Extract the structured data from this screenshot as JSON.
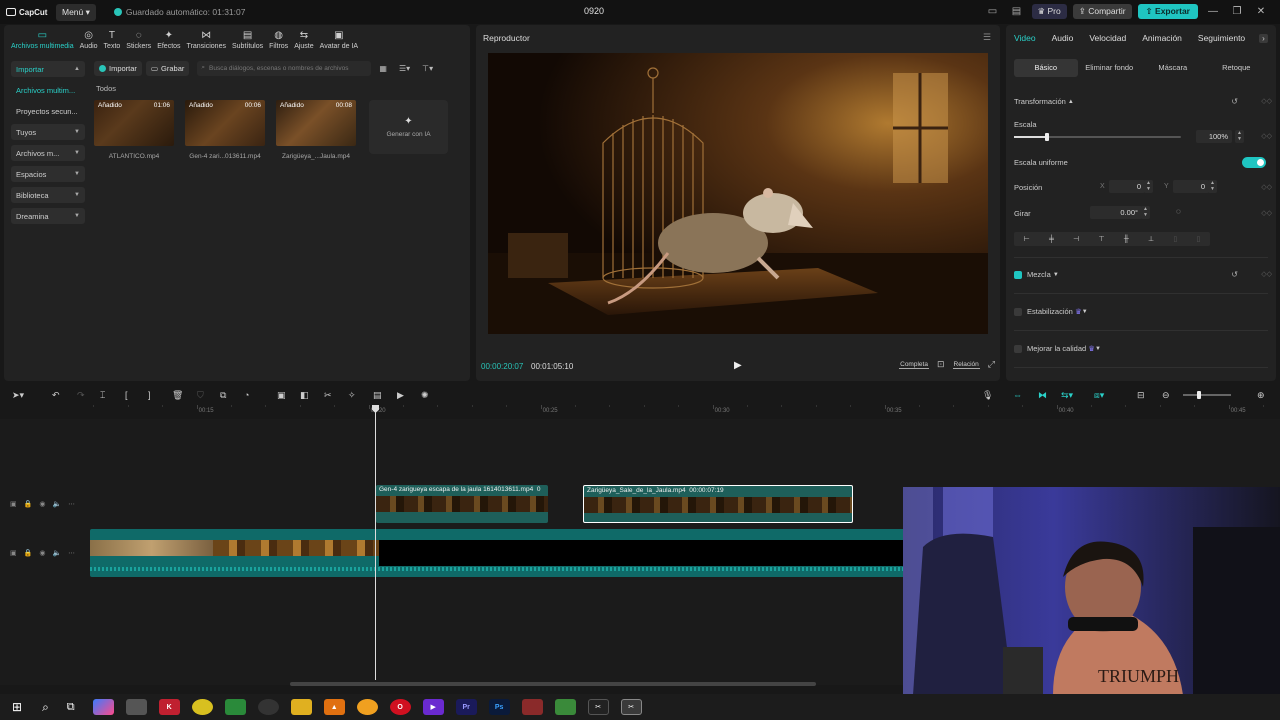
{
  "app": {
    "logo_text": "CapCut",
    "menu_label": "Menú",
    "autosave_text": "Guardado automático: 01:31:07",
    "project_title": "0920",
    "pro_label": "Pro",
    "share_label": "Compartir",
    "export_label": "Exportar"
  },
  "media_tabs": [
    {
      "label": "Archivos multimedia",
      "icon": "media-icon",
      "active": true
    },
    {
      "label": "Audio",
      "icon": "audio-icon"
    },
    {
      "label": "Texto",
      "icon": "text-icon"
    },
    {
      "label": "Stickers",
      "icon": "sticker-icon"
    },
    {
      "label": "Efectos",
      "icon": "effects-icon"
    },
    {
      "label": "Transiciones",
      "icon": "transitions-icon"
    },
    {
      "label": "Subtítulos",
      "icon": "subtitles-icon"
    },
    {
      "label": "Filtros",
      "icon": "filters-icon"
    },
    {
      "label": "Ajuste",
      "icon": "adjust-icon"
    },
    {
      "label": "Avatar de IA",
      "icon": "avatar-icon"
    }
  ],
  "side_nav": [
    {
      "label": "Importar",
      "boxed": true,
      "active": true
    },
    {
      "label": "Archivos multim...",
      "boxed": false,
      "active": true
    },
    {
      "label": "Proyectos secun...",
      "boxed": false
    },
    {
      "label": "Tuyos",
      "boxed": true
    },
    {
      "label": "Archivos m...",
      "boxed": true
    },
    {
      "label": "Espacios",
      "boxed": true
    },
    {
      "label": "Biblioteca",
      "boxed": true
    },
    {
      "label": "Dreamina",
      "boxed": true
    }
  ],
  "media_toolbar": {
    "import_label": "Importar",
    "record_label": "Grabar",
    "search_placeholder": "Busca diálogos, escenas o nombres de archivos"
  },
  "media_section_title": "Todos",
  "media_items": [
    {
      "badge": "Añadido",
      "duration": "01:06",
      "name": "ATLANTICO.mp4"
    },
    {
      "badge": "Añadido",
      "duration": "00:06",
      "name": "Gen-4 zari...013611.mp4"
    },
    {
      "badge": "Añadido",
      "duration": "00:08",
      "name": "Zarigüeya_...Jaula.mp4"
    }
  ],
  "generate_ai_label": "Generar con IA",
  "player": {
    "title": "Reproductor",
    "current_time": "00:00:20:07",
    "total_time": "00:01:05:10",
    "full_label": "Completa",
    "ratio_label": "Relación"
  },
  "props": {
    "tabs": [
      "Video",
      "Audio",
      "Velocidad",
      "Animación",
      "Seguimiento"
    ],
    "subtabs": [
      "Básico",
      "Eliminar fondo",
      "Máscara",
      "Retoque"
    ],
    "transform_label": "Transformación",
    "scale_label": "Escala",
    "scale_value": "100%",
    "scale_fraction": 0.2,
    "uniform_scale_label": "Escala uniforme",
    "position_label": "Posición",
    "pos_x_label": "X",
    "pos_x": "0",
    "pos_y_label": "Y",
    "pos_y": "0",
    "rotate_label": "Girar",
    "rotate_value": "0.00°",
    "blend_label": "Mezcla",
    "stabilize_label": "Estabilización",
    "quality_label": "Mejorar la calidad"
  },
  "timeline": {
    "ruler": [
      {
        "label": "00:15"
      },
      {
        "label": "00:20"
      },
      {
        "label": "00:25"
      },
      {
        "label": "00:30"
      },
      {
        "label": "00:35"
      },
      {
        "label": "00:40"
      },
      {
        "label": "00:45"
      }
    ],
    "clip1_label": "Gen-4 zarigueya escapa de la jaula 1614013611.mp4",
    "clip1_time": "0",
    "clip2_label": "Zarigüeya_Sale_de_la_Jaula.mp4",
    "clip2_time": "00:00:07:19"
  },
  "colors": {
    "accent": "#1fc5c1",
    "background": "#181818",
    "panel": "#222222"
  }
}
